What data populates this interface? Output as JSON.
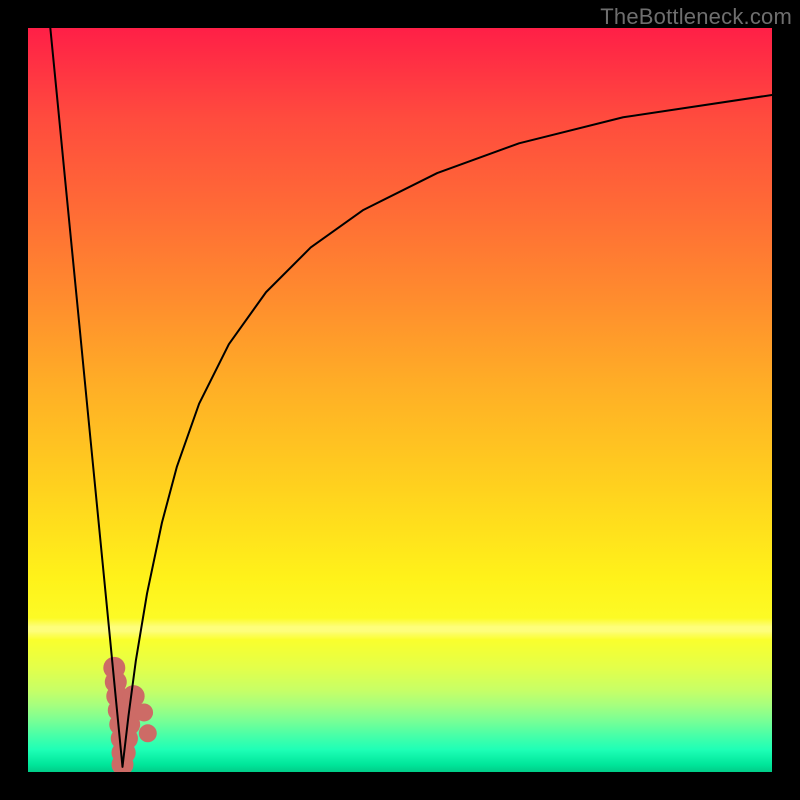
{
  "watermark": {
    "text": "TheBottleneck.com"
  },
  "chart_data": {
    "type": "line",
    "title": "",
    "xlabel": "",
    "ylabel": "",
    "xlim": [
      0,
      100
    ],
    "ylim": [
      0,
      100
    ],
    "grid": false,
    "legend": false,
    "background_gradient": {
      "direction": "vertical",
      "stops": [
        {
          "pct": 0,
          "color": "#ff1f47"
        },
        {
          "pct": 12,
          "color": "#ff4b3e"
        },
        {
          "pct": 24,
          "color": "#ff6a36"
        },
        {
          "pct": 36,
          "color": "#ff8b2e"
        },
        {
          "pct": 48,
          "color": "#ffae26"
        },
        {
          "pct": 62,
          "color": "#ffd21e"
        },
        {
          "pct": 74,
          "color": "#fff21a"
        },
        {
          "pct": 82,
          "color": "#fbff2b"
        },
        {
          "pct": 86,
          "color": "#e3ff4a"
        },
        {
          "pct": 89,
          "color": "#c7ff66"
        },
        {
          "pct": 91,
          "color": "#a6ff7e"
        },
        {
          "pct": 93,
          "color": "#7bff94"
        },
        {
          "pct": 95,
          "color": "#4affa7"
        },
        {
          "pct": 97,
          "color": "#1effb6"
        },
        {
          "pct": 99,
          "color": "#00e69a"
        },
        {
          "pct": 100,
          "color": "#00cc88"
        }
      ]
    },
    "series": [
      {
        "name": "left-branch",
        "stroke": "#000000",
        "stroke_width": 2,
        "x": [
          3.0,
          4.0,
          5.0,
          6.0,
          7.0,
          8.0,
          9.0,
          10.0,
          11.0,
          12.0,
          12.7
        ],
        "y": [
          100.0,
          89.8,
          79.5,
          69.3,
          59.1,
          48.8,
          38.6,
          28.4,
          18.2,
          7.9,
          0.7
        ]
      },
      {
        "name": "right-branch",
        "stroke": "#000000",
        "stroke_width": 2,
        "x": [
          12.7,
          13.5,
          14.5,
          16.0,
          18.0,
          20.0,
          23.0,
          27.0,
          32.0,
          38.0,
          45.0,
          55.0,
          66.0,
          80.0,
          100.0
        ],
        "y": [
          0.7,
          7.5,
          15.0,
          24.0,
          33.5,
          41.0,
          49.5,
          57.5,
          64.5,
          70.5,
          75.5,
          80.5,
          84.5,
          88.0,
          91.0
        ]
      }
    ],
    "markers": [
      {
        "name": "coral-dots",
        "color": "#cd6b66",
        "shape": "circle",
        "points": [
          {
            "x": 11.6,
            "y": 14.0,
            "r": 11
          },
          {
            "x": 11.8,
            "y": 12.1,
            "r": 11
          },
          {
            "x": 12.0,
            "y": 10.2,
            "r": 11
          },
          {
            "x": 12.2,
            "y": 8.3,
            "r": 11
          },
          {
            "x": 12.4,
            "y": 6.4,
            "r": 11
          },
          {
            "x": 12.6,
            "y": 4.5,
            "r": 11
          },
          {
            "x": 12.7,
            "y": 2.6,
            "r": 11
          },
          {
            "x": 12.7,
            "y": 1.0,
            "r": 11
          },
          {
            "x": 13.0,
            "y": 2.6,
            "r": 11
          },
          {
            "x": 13.3,
            "y": 4.5,
            "r": 11
          },
          {
            "x": 13.6,
            "y": 6.4,
            "r": 11
          },
          {
            "x": 13.9,
            "y": 8.3,
            "r": 11
          },
          {
            "x": 14.2,
            "y": 10.2,
            "r": 11
          },
          {
            "x": 15.6,
            "y": 8.0,
            "r": 9
          },
          {
            "x": 16.1,
            "y": 5.2,
            "r": 9
          }
        ]
      }
    ]
  }
}
